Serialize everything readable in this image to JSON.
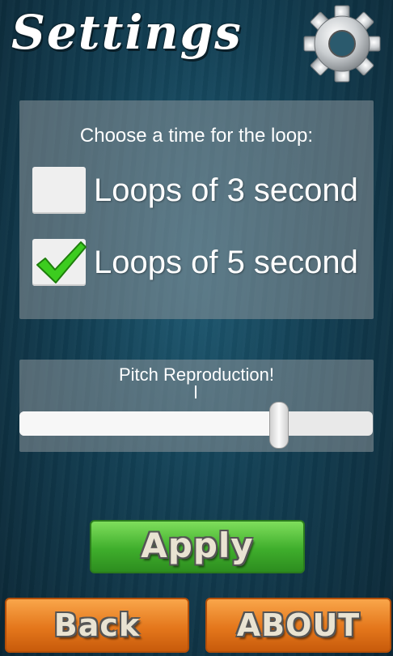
{
  "header": {
    "title": "Settings",
    "icon": "gear-icon"
  },
  "loop_panel": {
    "prompt": "Choose a time for the loop:",
    "options": [
      {
        "label": "Loops of 3 second",
        "checked": false
      },
      {
        "label": "Loops of 5 second",
        "checked": true
      }
    ],
    "check_icon": "checkmark-icon"
  },
  "pitch": {
    "label": "Pitch Reproduction!",
    "value_fraction": 0.735
  },
  "buttons": {
    "apply": "Apply",
    "back": "Back",
    "about": "ABOUT"
  },
  "colors": {
    "apply_green": "#3fae2c",
    "orange": "#e4771c",
    "background": "#123e52",
    "check_green": "#3ccc1f"
  }
}
